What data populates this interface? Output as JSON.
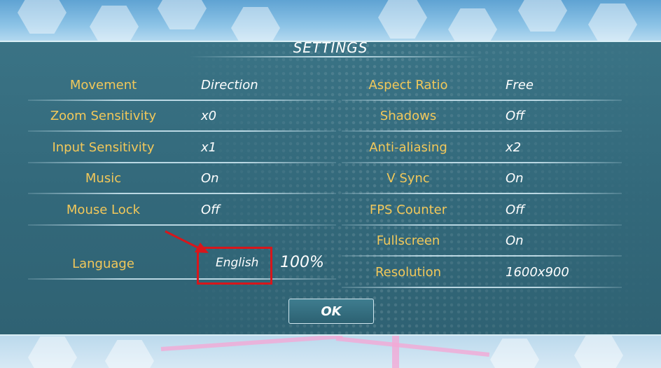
{
  "title": "SETTINGS",
  "left_settings": [
    {
      "label": "Movement",
      "value": "Direction"
    },
    {
      "label": "Zoom Sensitivity",
      "value": "x0"
    },
    {
      "label": "Input Sensitivity",
      "value": "x1"
    },
    {
      "label": "Music",
      "value": "On"
    },
    {
      "label": "Mouse Lock",
      "value": "Off"
    }
  ],
  "language": {
    "label": "Language",
    "value": "English",
    "progress": "100%"
  },
  "right_settings": [
    {
      "label": "Aspect Ratio",
      "value": "Free"
    },
    {
      "label": "Shadows",
      "value": "Off"
    },
    {
      "label": "Anti-aliasing",
      "value": "x2"
    },
    {
      "label": "V Sync",
      "value": "On"
    },
    {
      "label": "FPS Counter",
      "value": "Off"
    },
    {
      "label": "Fullscreen",
      "value": "On"
    },
    {
      "label": "Resolution",
      "value": "1600x900"
    }
  ],
  "ok_label": "OK",
  "colors": {
    "label": "#f2c85a",
    "value": "#ffffff",
    "panel": "#33697b",
    "highlight": "#d8161b"
  }
}
